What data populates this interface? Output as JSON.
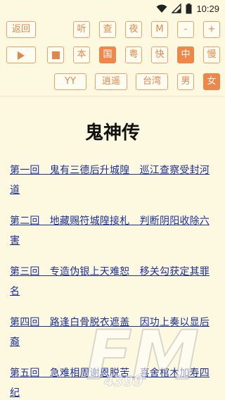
{
  "status": {
    "time": "10:29"
  },
  "toolbar": {
    "row1": [
      "返回",
      "听",
      "查",
      "夜",
      "M",
      "-",
      "+"
    ],
    "row2": [
      "本",
      "国",
      "粤",
      "快",
      "中",
      "慢"
    ],
    "row3": [
      "YY",
      "逍遥",
      "台湾",
      "男",
      "女"
    ]
  },
  "book": {
    "title": "鬼神传",
    "chapters": [
      "第一回　鬼有三德后升城隍　巡江查察受封河道",
      "第二回　地藏赐符城隍接札　判断阴阳收除六害",
      "第三回　专造伪银上天难恕　移关勾获定其罪名",
      "第四回　路逢白骨脱衣遮盖　因功上奏以显后裔",
      "第五回　急难相周谢恩脱苦　喜舍棺木加寿四纪"
    ]
  },
  "watermark": {
    "text": "FM",
    "sub": "4399"
  },
  "colors": {
    "accent": "#f0874a",
    "background": "#fdf9e0",
    "link": "#1c2fa0"
  }
}
